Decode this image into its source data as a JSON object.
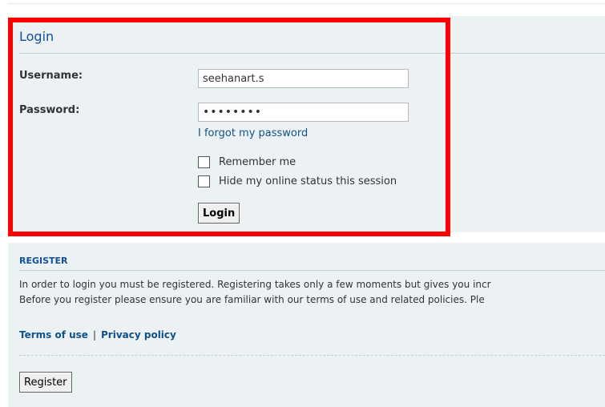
{
  "login": {
    "title": "Login",
    "username_label": "Username:",
    "username_value": "seehanart.s",
    "password_label": "Password:",
    "password_value": "••••••••",
    "forgot_link": "I forgot my password",
    "remember_me_label": "Remember me",
    "remember_me_checked": false,
    "hide_status_label": "Hide my online status this session",
    "hide_status_checked": false,
    "login_button": "Login"
  },
  "register": {
    "title": "REGISTER",
    "text_line1": "In order to login you must be registered. Registering takes only a few moments but gives you incr",
    "text_line2": "Before you register please ensure you are familiar with our terms of use and related policies. Ple",
    "terms_link": "Terms of use",
    "separator": "|",
    "privacy_link": "Privacy policy",
    "register_button": "Register"
  },
  "colors": {
    "panel_bg": "#ecf1f3",
    "link": "#105289",
    "title": "#115098",
    "highlight_frame": "#ff0000"
  }
}
